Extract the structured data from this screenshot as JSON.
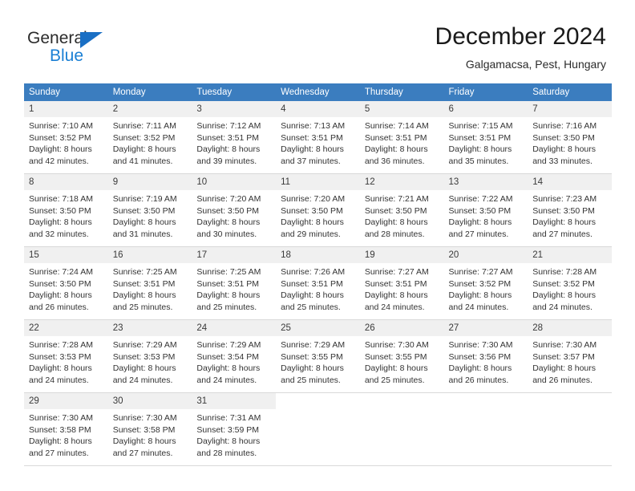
{
  "brand": {
    "name_part1": "General",
    "name_part2": "Blue",
    "accent_color": "#1a7fd4",
    "triangle_color": "#1a6fc4"
  },
  "header": {
    "title": "December 2024",
    "subtitle": "Galgamacsa, Pest, Hungary"
  },
  "calendar": {
    "header_bg": "#3b7dbf",
    "weekdays": [
      "Sunday",
      "Monday",
      "Tuesday",
      "Wednesday",
      "Thursday",
      "Friday",
      "Saturday"
    ],
    "weeks": [
      [
        {
          "day": "1",
          "sunrise": "Sunrise: 7:10 AM",
          "sunset": "Sunset: 3:52 PM",
          "daylight1": "Daylight: 8 hours",
          "daylight2": "and 42 minutes."
        },
        {
          "day": "2",
          "sunrise": "Sunrise: 7:11 AM",
          "sunset": "Sunset: 3:52 PM",
          "daylight1": "Daylight: 8 hours",
          "daylight2": "and 41 minutes."
        },
        {
          "day": "3",
          "sunrise": "Sunrise: 7:12 AM",
          "sunset": "Sunset: 3:51 PM",
          "daylight1": "Daylight: 8 hours",
          "daylight2": "and 39 minutes."
        },
        {
          "day": "4",
          "sunrise": "Sunrise: 7:13 AM",
          "sunset": "Sunset: 3:51 PM",
          "daylight1": "Daylight: 8 hours",
          "daylight2": "and 37 minutes."
        },
        {
          "day": "5",
          "sunrise": "Sunrise: 7:14 AM",
          "sunset": "Sunset: 3:51 PM",
          "daylight1": "Daylight: 8 hours",
          "daylight2": "and 36 minutes."
        },
        {
          "day": "6",
          "sunrise": "Sunrise: 7:15 AM",
          "sunset": "Sunset: 3:51 PM",
          "daylight1": "Daylight: 8 hours",
          "daylight2": "and 35 minutes."
        },
        {
          "day": "7",
          "sunrise": "Sunrise: 7:16 AM",
          "sunset": "Sunset: 3:50 PM",
          "daylight1": "Daylight: 8 hours",
          "daylight2": "and 33 minutes."
        }
      ],
      [
        {
          "day": "8",
          "sunrise": "Sunrise: 7:18 AM",
          "sunset": "Sunset: 3:50 PM",
          "daylight1": "Daylight: 8 hours",
          "daylight2": "and 32 minutes."
        },
        {
          "day": "9",
          "sunrise": "Sunrise: 7:19 AM",
          "sunset": "Sunset: 3:50 PM",
          "daylight1": "Daylight: 8 hours",
          "daylight2": "and 31 minutes."
        },
        {
          "day": "10",
          "sunrise": "Sunrise: 7:20 AM",
          "sunset": "Sunset: 3:50 PM",
          "daylight1": "Daylight: 8 hours",
          "daylight2": "and 30 minutes."
        },
        {
          "day": "11",
          "sunrise": "Sunrise: 7:20 AM",
          "sunset": "Sunset: 3:50 PM",
          "daylight1": "Daylight: 8 hours",
          "daylight2": "and 29 minutes."
        },
        {
          "day": "12",
          "sunrise": "Sunrise: 7:21 AM",
          "sunset": "Sunset: 3:50 PM",
          "daylight1": "Daylight: 8 hours",
          "daylight2": "and 28 minutes."
        },
        {
          "day": "13",
          "sunrise": "Sunrise: 7:22 AM",
          "sunset": "Sunset: 3:50 PM",
          "daylight1": "Daylight: 8 hours",
          "daylight2": "and 27 minutes."
        },
        {
          "day": "14",
          "sunrise": "Sunrise: 7:23 AM",
          "sunset": "Sunset: 3:50 PM",
          "daylight1": "Daylight: 8 hours",
          "daylight2": "and 27 minutes."
        }
      ],
      [
        {
          "day": "15",
          "sunrise": "Sunrise: 7:24 AM",
          "sunset": "Sunset: 3:50 PM",
          "daylight1": "Daylight: 8 hours",
          "daylight2": "and 26 minutes."
        },
        {
          "day": "16",
          "sunrise": "Sunrise: 7:25 AM",
          "sunset": "Sunset: 3:51 PM",
          "daylight1": "Daylight: 8 hours",
          "daylight2": "and 25 minutes."
        },
        {
          "day": "17",
          "sunrise": "Sunrise: 7:25 AM",
          "sunset": "Sunset: 3:51 PM",
          "daylight1": "Daylight: 8 hours",
          "daylight2": "and 25 minutes."
        },
        {
          "day": "18",
          "sunrise": "Sunrise: 7:26 AM",
          "sunset": "Sunset: 3:51 PM",
          "daylight1": "Daylight: 8 hours",
          "daylight2": "and 25 minutes."
        },
        {
          "day": "19",
          "sunrise": "Sunrise: 7:27 AM",
          "sunset": "Sunset: 3:51 PM",
          "daylight1": "Daylight: 8 hours",
          "daylight2": "and 24 minutes."
        },
        {
          "day": "20",
          "sunrise": "Sunrise: 7:27 AM",
          "sunset": "Sunset: 3:52 PM",
          "daylight1": "Daylight: 8 hours",
          "daylight2": "and 24 minutes."
        },
        {
          "day": "21",
          "sunrise": "Sunrise: 7:28 AM",
          "sunset": "Sunset: 3:52 PM",
          "daylight1": "Daylight: 8 hours",
          "daylight2": "and 24 minutes."
        }
      ],
      [
        {
          "day": "22",
          "sunrise": "Sunrise: 7:28 AM",
          "sunset": "Sunset: 3:53 PM",
          "daylight1": "Daylight: 8 hours",
          "daylight2": "and 24 minutes."
        },
        {
          "day": "23",
          "sunrise": "Sunrise: 7:29 AM",
          "sunset": "Sunset: 3:53 PM",
          "daylight1": "Daylight: 8 hours",
          "daylight2": "and 24 minutes."
        },
        {
          "day": "24",
          "sunrise": "Sunrise: 7:29 AM",
          "sunset": "Sunset: 3:54 PM",
          "daylight1": "Daylight: 8 hours",
          "daylight2": "and 24 minutes."
        },
        {
          "day": "25",
          "sunrise": "Sunrise: 7:29 AM",
          "sunset": "Sunset: 3:55 PM",
          "daylight1": "Daylight: 8 hours",
          "daylight2": "and 25 minutes."
        },
        {
          "day": "26",
          "sunrise": "Sunrise: 7:30 AM",
          "sunset": "Sunset: 3:55 PM",
          "daylight1": "Daylight: 8 hours",
          "daylight2": "and 25 minutes."
        },
        {
          "day": "27",
          "sunrise": "Sunrise: 7:30 AM",
          "sunset": "Sunset: 3:56 PM",
          "daylight1": "Daylight: 8 hours",
          "daylight2": "and 26 minutes."
        },
        {
          "day": "28",
          "sunrise": "Sunrise: 7:30 AM",
          "sunset": "Sunset: 3:57 PM",
          "daylight1": "Daylight: 8 hours",
          "daylight2": "and 26 minutes."
        }
      ],
      [
        {
          "day": "29",
          "sunrise": "Sunrise: 7:30 AM",
          "sunset": "Sunset: 3:58 PM",
          "daylight1": "Daylight: 8 hours",
          "daylight2": "and 27 minutes."
        },
        {
          "day": "30",
          "sunrise": "Sunrise: 7:30 AM",
          "sunset": "Sunset: 3:58 PM",
          "daylight1": "Daylight: 8 hours",
          "daylight2": "and 27 minutes."
        },
        {
          "day": "31",
          "sunrise": "Sunrise: 7:31 AM",
          "sunset": "Sunset: 3:59 PM",
          "daylight1": "Daylight: 8 hours",
          "daylight2": "and 28 minutes."
        },
        {
          "day": "",
          "sunrise": "",
          "sunset": "",
          "daylight1": "",
          "daylight2": ""
        },
        {
          "day": "",
          "sunrise": "",
          "sunset": "",
          "daylight1": "",
          "daylight2": ""
        },
        {
          "day": "",
          "sunrise": "",
          "sunset": "",
          "daylight1": "",
          "daylight2": ""
        },
        {
          "day": "",
          "sunrise": "",
          "sunset": "",
          "daylight1": "",
          "daylight2": ""
        }
      ]
    ]
  }
}
